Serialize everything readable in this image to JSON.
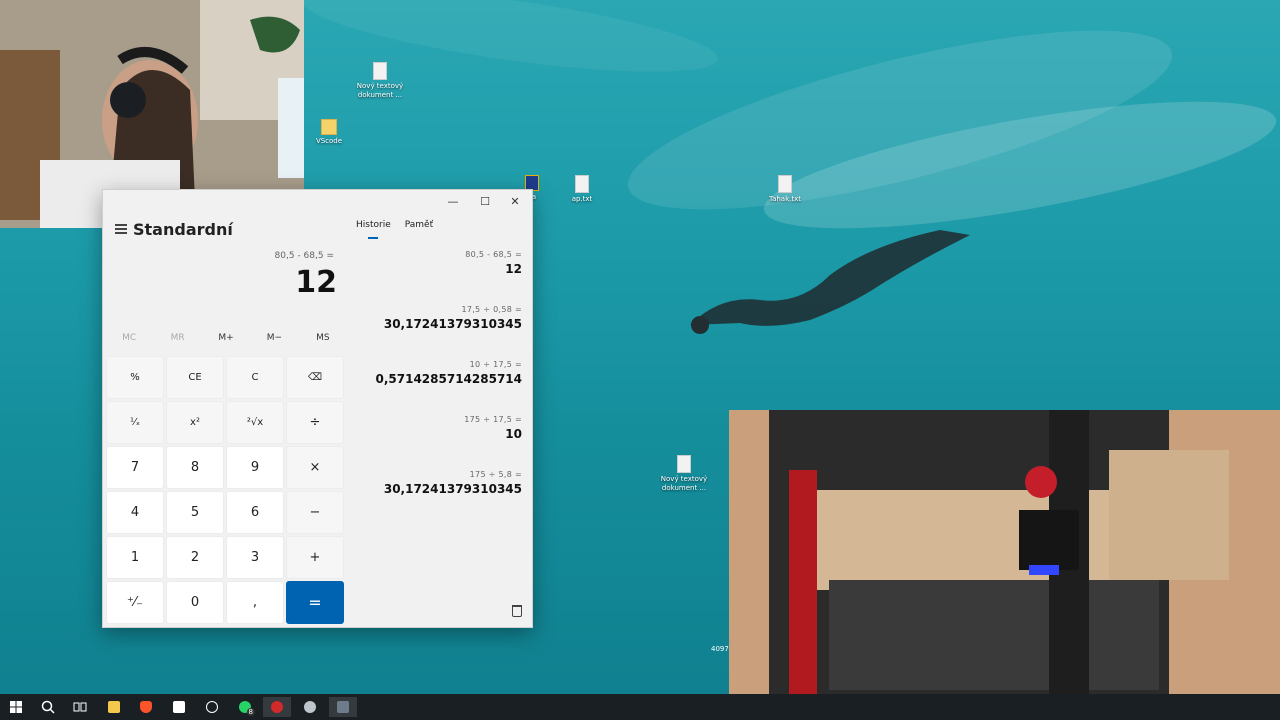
{
  "desktop": {
    "icons": [
      {
        "label": "Nový textový dokument ...",
        "kind": "text"
      },
      {
        "label": "VScode",
        "kind": "folder"
      },
      {
        "label": "va",
        "kind": "app"
      },
      {
        "label": "ap.txt",
        "kind": "text"
      },
      {
        "label": "Tahak.txt",
        "kind": "text"
      },
      {
        "label": "Nový textový dokument ...",
        "kind": "text"
      }
    ],
    "partial_label": "4097"
  },
  "calculator": {
    "mode": "Standardní",
    "expression": "80,5 - 68,5 =",
    "result": "12",
    "memory": [
      "MC",
      "MR",
      "M+",
      "M−",
      "MS"
    ],
    "keys": [
      "%",
      "CE",
      "C",
      "⌫",
      "¹⁄ₓ",
      "x²",
      "²√x",
      "÷",
      "7",
      "8",
      "9",
      "×",
      "4",
      "5",
      "6",
      "−",
      "1",
      "2",
      "3",
      "+",
      "⁺⁄₋",
      "0",
      ",",
      "="
    ],
    "tabs": [
      "Historie",
      "Paměť"
    ],
    "history": [
      {
        "expr": "80,5   -   68,5 =",
        "result": "12"
      },
      {
        "expr": "17,5   ÷   0,58 =",
        "result": "30,17241379310345"
      },
      {
        "expr": "10   ÷   17,5 =",
        "result": "0,5714285714285714"
      },
      {
        "expr": "175   ÷   17,5 =",
        "result": "10"
      },
      {
        "expr": "175   ÷   5,8 =",
        "result": "30,17241379310345"
      }
    ],
    "window_buttons": [
      "—",
      "☐",
      "✕"
    ]
  },
  "taskbar": {
    "items": [
      "start",
      "search",
      "task-view",
      "file-explorer",
      "brave",
      "app-a",
      "app-circle",
      "whatsapp",
      "app-red",
      "app-gray",
      "calculator"
    ],
    "whatsapp_badge": "8"
  },
  "colors": {
    "accent": "#0063b1",
    "taskbar": "#1a1f24",
    "water": "#1c9aa8"
  }
}
